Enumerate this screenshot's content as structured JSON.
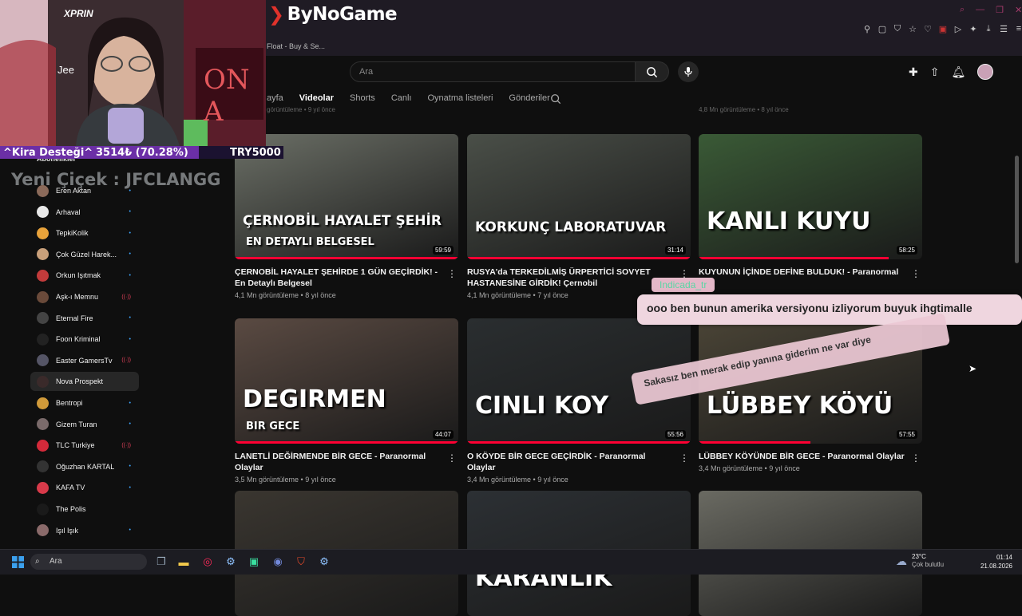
{
  "browser": {
    "logo_text": "ByNoGame",
    "bookmark": "Float - Buy & Se...",
    "icons": [
      "pin-icon",
      "square-icon",
      "shield-icon",
      "star-icon",
      "heart-icon",
      "extension-icon",
      "download-icon",
      "menu-icon"
    ]
  },
  "header": {
    "search_placeholder": "Ara",
    "icons": [
      "create-icon",
      "upload-icon",
      "bell-icon",
      "avatar"
    ]
  },
  "tabs": [
    {
      "label": "ayfa",
      "active": false
    },
    {
      "label": "Videolar",
      "active": true
    },
    {
      "label": "Shorts",
      "active": false
    },
    {
      "label": "Canlı",
      "active": false
    },
    {
      "label": "Oynatma listeleri",
      "active": false
    },
    {
      "label": "Gönderiler",
      "active": false
    }
  ],
  "top_meta": {
    "left": "görüntüleme • 9 yıl önce",
    "right": "4,8 Mn görüntüleme • 8 yıl önce"
  },
  "sidebar": {
    "header": "Abonelikler",
    "items": [
      {
        "label": "Eren Aktan",
        "color": "#8b6a5a",
        "dot": "•"
      },
      {
        "label": "Arhaval",
        "color": "#e8e8e8",
        "dot": "•"
      },
      {
        "label": "TepkiKolik",
        "color": "#e8a23a",
        "dot": "•"
      },
      {
        "label": "Çok Güzel Harek...",
        "color": "#c9a07a",
        "dot": "•"
      },
      {
        "label": "Orkun Işıtmak",
        "color": "#c23b3b",
        "dot": "•"
      },
      {
        "label": "Aşk-ı Memnu",
        "color": "#6a4a3a",
        "dot": "((·))"
      },
      {
        "label": "Eternal Fire",
        "color": "#444",
        "dot": "•"
      },
      {
        "label": "Foon Kriminal",
        "color": "#222",
        "dot": "•"
      },
      {
        "label": "Easter GamersTv",
        "color": "#556",
        "dot": "((·))"
      },
      {
        "label": "Nova Prospekt",
        "color": "#3a2a2a",
        "dot": ""
      },
      {
        "label": "Bentropi",
        "color": "#d09a3a",
        "dot": "•"
      },
      {
        "label": "Gizem Turan",
        "color": "#7a6a6a",
        "dot": "•"
      },
      {
        "label": "TLC Turkiye",
        "color": "#d42a3a",
        "dot": "((·))"
      },
      {
        "label": "Oğuzhan KARTAL",
        "color": "#333",
        "dot": "•"
      },
      {
        "label": "KAFA TV",
        "color": "#d83a4a",
        "dot": "•"
      },
      {
        "label": "The Polis",
        "color": "#1a1a1a",
        "dot": ""
      },
      {
        "label": "Işıl Işık",
        "color": "#8a6a6a",
        "dot": "•"
      }
    ],
    "selected_index": 9
  },
  "videos": [
    {
      "title": "ÇERNOBİL HAYALET ŞEHİRDE 1 GÜN GEÇİRDİK! - En Detaylı Belgesel",
      "meta": "4,1 Mn görüntüleme • 8 yıl önce",
      "duration": "59:59",
      "thumb_text": "ÇERNOBİL HAYALET ŞEHİR",
      "thumb_sub": "EN DETAYLI BELGESEL",
      "bg": "#6b6f66",
      "progress": 1.0
    },
    {
      "title": "RUSYA'da TERKEDİLMİŞ ÜRPERTİCİ SOVYET HASTANESİNE GİRDİK! Çernobil",
      "meta": "4,1 Mn görüntüleme • 7 yıl önce",
      "duration": "31:14",
      "thumb_text": "KORKUNÇ LABORATUVAR",
      "thumb_sub": "",
      "bg": "#4a4f48",
      "progress": 1.0
    },
    {
      "title": "KUYUNUN İÇİNDE DEFİNE BULDUK! - Paranormal",
      "meta": "",
      "duration": "58:25",
      "thumb_text": "KANLI KUYU",
      "thumb_sub": "",
      "bg": "#3a5a36",
      "progress": 0.85
    },
    {
      "title": "LANETLİ DEĞİRMENDE BİR GECE - Paranormal Olaylar",
      "meta": "3,5 Mn görüntüleme • 9 yıl önce",
      "duration": "44:07",
      "thumb_text": "DEGIRMEN",
      "thumb_sub": "BIR GECE",
      "bg": "#5a4a42",
      "progress": 1.0
    },
    {
      "title": "O KÖYDE BİR GECE GEÇİRDİK - Paranormal Olaylar",
      "meta": "3,4 Mn görüntüleme • 9 yıl önce",
      "duration": "55:56",
      "thumb_text": "CINLI KOY",
      "thumb_sub": "",
      "bg": "#2a2e30",
      "progress": 1.0
    },
    {
      "title": "LÜBBEY KÖYÜNDE BİR GECE - Paranormal Olaylar",
      "meta": "3,4 Mn görüntüleme • 9 yıl önce",
      "duration": "57:55",
      "thumb_text": "LÜBBEY KÖYÜ",
      "thumb_sub": "",
      "bg": "#4a4436",
      "progress": 0.5
    },
    {
      "title": "",
      "meta": "",
      "duration": "",
      "thumb_text": "",
      "thumb_sub": "",
      "bg": "#3a3630",
      "progress": 0
    },
    {
      "title": "",
      "meta": "",
      "duration": "",
      "thumb_text": "KARANLIK",
      "thumb_sub": "",
      "bg": "#2c3034",
      "progress": 0
    },
    {
      "title": "",
      "meta": "",
      "duration": "",
      "thumb_text": "",
      "thumb_sub": "",
      "bg": "#6a6a62",
      "progress": 0
    }
  ],
  "stream_overlay": {
    "webcam_brand": "XPRIN",
    "webcam_name": "Jee",
    "poster_text": "ON A",
    "donation_label": "^Kira Desteği^",
    "donation_amount": "3514₺ (70.28%)",
    "donation_goal": "TRY5000",
    "new_follower": "Yeni Çiçek : JFCLANGG",
    "chat_user": "Indicada_tr",
    "chat_message": "ooo ben bunun amerika versiyonu izliyorum buyuk ihgtimalle",
    "chat_message2": "Sakasız ben merak edip yanına giderim ne var diye"
  },
  "taskbar": {
    "search_label": "Ara",
    "temperature": "23°C",
    "weather": "Çok bulutlu",
    "time": "01:14",
    "date": "21.08.2026"
  }
}
